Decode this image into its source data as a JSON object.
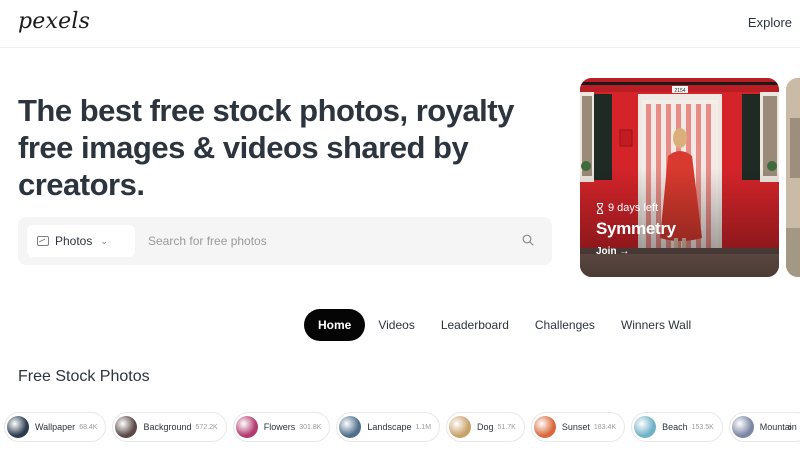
{
  "header": {
    "logo": "pexels",
    "explore_label": "Explore"
  },
  "hero": {
    "title": "The best free stock photos, royalty free images & videos shared by creators."
  },
  "search": {
    "type_label": "Photos",
    "placeholder": "Search for free photos"
  },
  "challenge": {
    "days_left": "9 days left",
    "title": "Symmetry",
    "join_label": "Join →",
    "door_number": "2154"
  },
  "tabs": [
    {
      "label": "Home",
      "active": true
    },
    {
      "label": "Videos",
      "active": false
    },
    {
      "label": "Leaderboard",
      "active": false
    },
    {
      "label": "Challenges",
      "active": false
    },
    {
      "label": "Winners Wall",
      "active": false
    }
  ],
  "section": {
    "title": "Free Stock Photos"
  },
  "chips": [
    {
      "label": "Wallpaper",
      "count": "68.4K",
      "color": "#2a3a4f"
    },
    {
      "label": "Background",
      "count": "572.2K",
      "color": "#5a4a48"
    },
    {
      "label": "Flowers",
      "count": "301.8K",
      "color": "#b23a6e"
    },
    {
      "label": "Landscape",
      "count": "1.1M",
      "color": "#4d6f8c"
    },
    {
      "label": "Dog",
      "count": "51.7K",
      "color": "#c9a26a"
    },
    {
      "label": "Sunset",
      "count": "183.4K",
      "color": "#d9683a"
    },
    {
      "label": "Beach",
      "count": "153.5K",
      "color": "#6fb1c7"
    },
    {
      "label": "Mountain",
      "count": "",
      "color": "#7b86a3"
    }
  ],
  "colors": {
    "text": "#2c343e",
    "active_tab_bg": "#050505",
    "search_bg": "#f5f5f5",
    "card_red": "#d6262a"
  }
}
